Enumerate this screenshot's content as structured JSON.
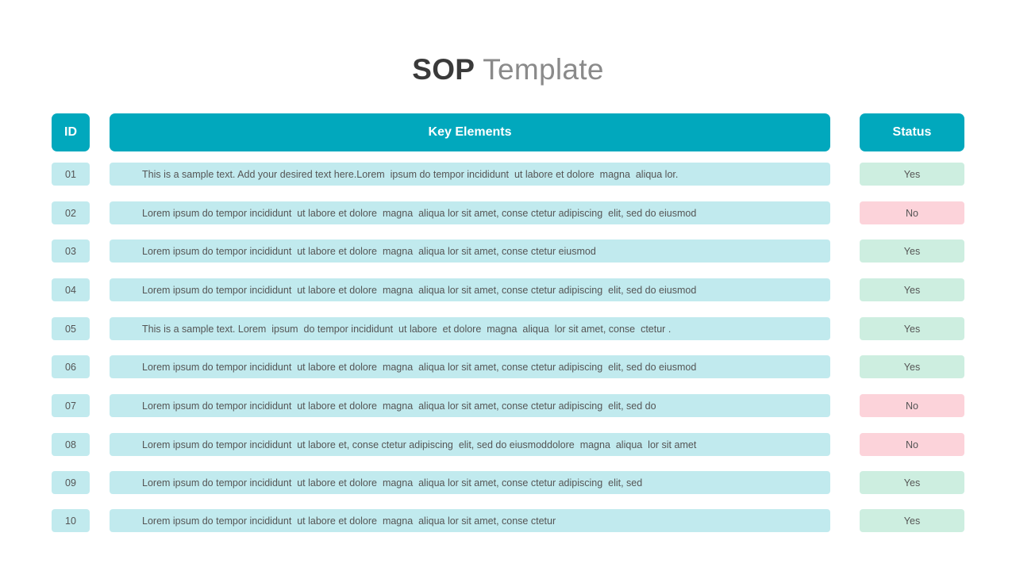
{
  "title": {
    "strong": "SOP",
    "light": "Template"
  },
  "headers": {
    "id": "ID",
    "key": "Key Elements",
    "status": "Status"
  },
  "colors": {
    "header": "#01a8bd",
    "row": "#c1eaee",
    "yes": "#cdeee0",
    "no": "#fcd3da"
  },
  "rows": [
    {
      "id": "01",
      "text": "This is a sample text. Add your desired text here.Lorem  ipsum do tempor incididunt  ut labore et dolore  magna  aliqua lor.",
      "status": "Yes"
    },
    {
      "id": "02",
      "text": "Lorem ipsum do tempor incididunt  ut labore et dolore  magna  aliqua lor sit amet, conse ctetur adipiscing  elit, sed do eiusmod",
      "status": "No"
    },
    {
      "id": "03",
      "text": "Lorem ipsum do tempor incididunt  ut labore et dolore  magna  aliqua lor sit amet, conse ctetur eiusmod",
      "status": "Yes"
    },
    {
      "id": "04",
      "text": "Lorem ipsum do tempor incididunt  ut labore et dolore  magna  aliqua lor sit amet, conse ctetur adipiscing  elit, sed do eiusmod",
      "status": "Yes"
    },
    {
      "id": "05",
      "text": "This is a sample text. Lorem  ipsum  do tempor incididunt  ut labore  et dolore  magna  aliqua  lor sit amet, conse  ctetur .",
      "status": "Yes"
    },
    {
      "id": "06",
      "text": "Lorem ipsum do tempor incididunt  ut labore et dolore  magna  aliqua lor sit amet, conse ctetur adipiscing  elit, sed do eiusmod",
      "status": "Yes"
    },
    {
      "id": "07",
      "text": "Lorem ipsum do tempor incididunt  ut labore et dolore  magna  aliqua lor sit amet, conse ctetur adipiscing  elit, sed do",
      "status": "No"
    },
    {
      "id": "08",
      "text": "Lorem ipsum do tempor incididunt  ut labore et, conse ctetur adipiscing  elit, sed do eiusmoddolore  magna  aliqua  lor sit amet",
      "status": "No"
    },
    {
      "id": "09",
      "text": "Lorem ipsum do tempor incididunt  ut labore et dolore  magna  aliqua lor sit amet, conse ctetur adipiscing  elit, sed",
      "status": "Yes"
    },
    {
      "id": "10",
      "text": "Lorem ipsum do tempor incididunt  ut labore et dolore  magna  aliqua lor sit amet, conse ctetur",
      "status": "Yes"
    }
  ]
}
